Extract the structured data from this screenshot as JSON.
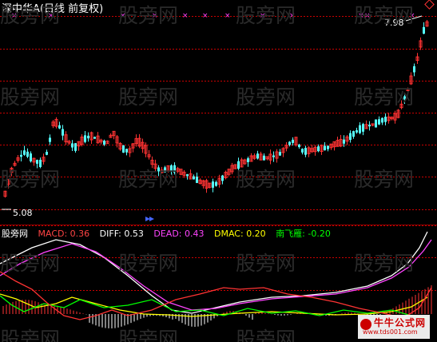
{
  "title": "深中华A(日线 前复权)",
  "price_labels": {
    "high": "7.98",
    "low": "5.08"
  },
  "watermark": "股旁网",
  "indicator": {
    "name": "股旁网",
    "macd": "MACD: 0.36",
    "diff": "DIFF: 0.53",
    "dead": "DEAD: 0.43",
    "dmac": "DMAC: 0.20",
    "nfy": "南飞雁: -0.20"
  },
  "badge": {
    "text": "牛牛公式网",
    "url": "www.tds001.com"
  },
  "colors": {
    "up": "#ff3333",
    "down": "#55ffff",
    "grid": "#cc0000",
    "macd_label": "#ff4444",
    "diff_label": "#ffffff",
    "dead_label": "#ff44ff",
    "dmac_label": "#ffff00",
    "nfy_label": "#00ff00",
    "marker": "#ff44ff"
  },
  "chart_data": {
    "type": "candlestick",
    "price_range": [
      5.08,
      7.98
    ],
    "high_marker": 7.98,
    "low_marker": 5.08
  }
}
